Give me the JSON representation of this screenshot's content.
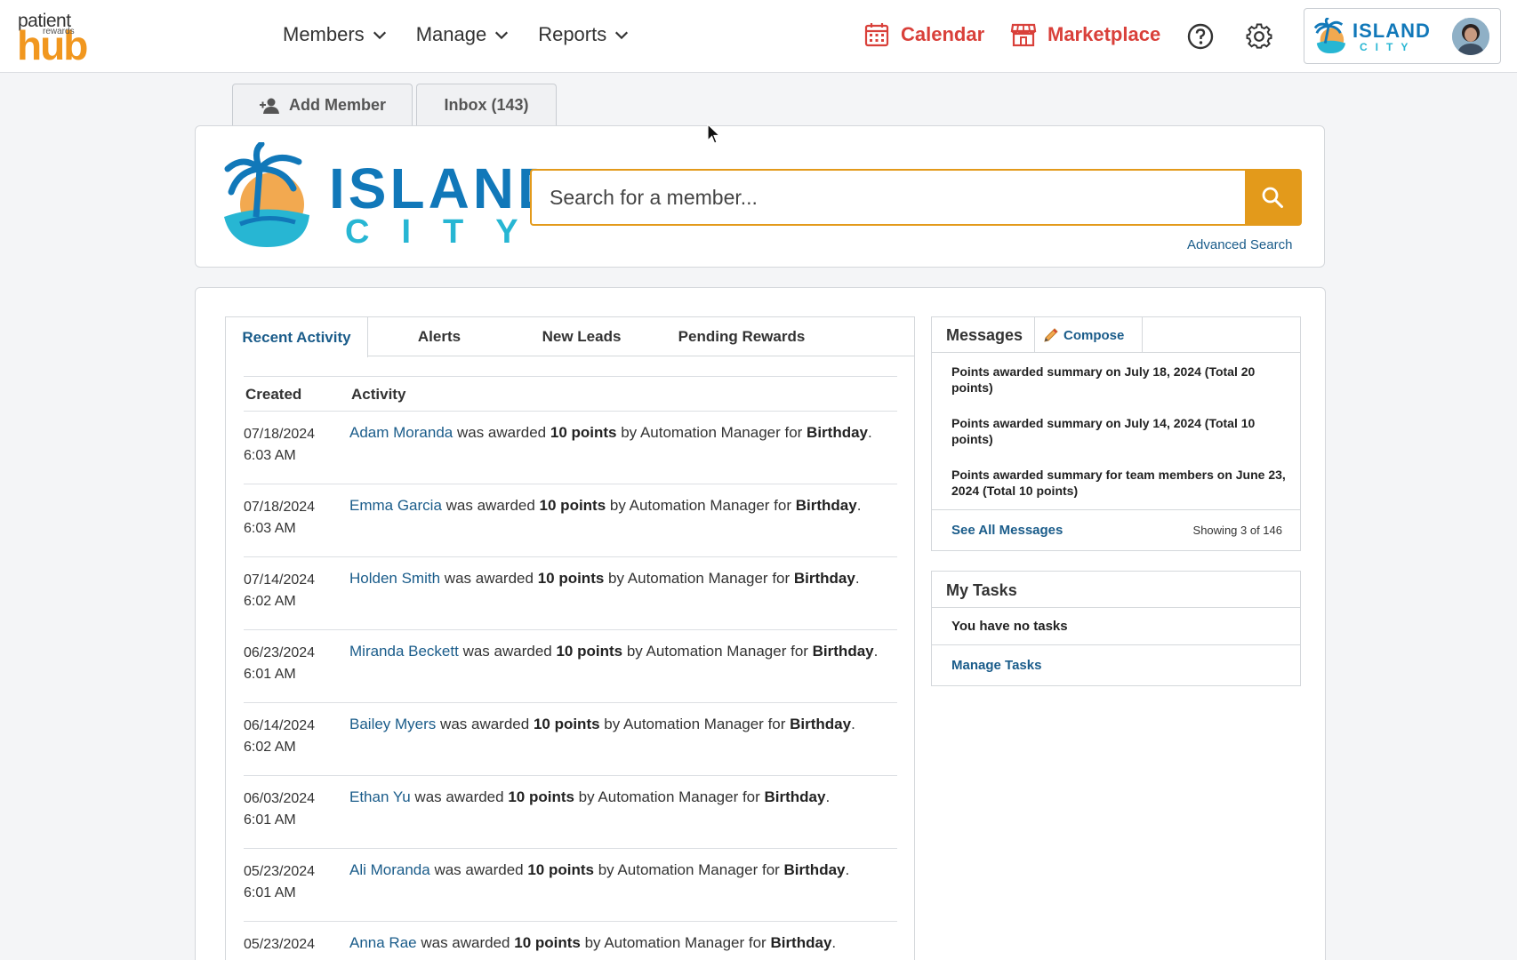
{
  "brand": {
    "line1": "patient",
    "line2": "rewards",
    "line3": "hub"
  },
  "nav": [
    {
      "label": "Members"
    },
    {
      "label": "Manage"
    },
    {
      "label": "Reports"
    }
  ],
  "top_links": {
    "calendar": "Calendar",
    "marketplace": "Marketplace"
  },
  "org": {
    "name_line1": "ISLAND",
    "name_line2": "CITY"
  },
  "action_tabs": {
    "add_member": "Add Member",
    "inbox": "Inbox (143)"
  },
  "search": {
    "placeholder": "Search for a member...",
    "advanced": "Advanced Search"
  },
  "activity": {
    "tabs": [
      "Recent Activity",
      "Alerts",
      "New Leads",
      "Pending Rewards"
    ],
    "columns": {
      "created": "Created",
      "activity": "Activity"
    },
    "rows": [
      {
        "date": "07/18/2024",
        "time": "6:03 AM",
        "member": "Adam Moranda",
        "t1": " was awarded ",
        "points": "10 points",
        "t2": " by Automation Manager for ",
        "reason": "Birthday",
        "end": "."
      },
      {
        "date": "07/18/2024",
        "time": "6:03 AM",
        "member": "Emma Garcia",
        "t1": " was awarded ",
        "points": "10 points",
        "t2": " by Automation Manager for ",
        "reason": "Birthday",
        "end": "."
      },
      {
        "date": "07/14/2024",
        "time": "6:02 AM",
        "member": "Holden Smith",
        "t1": " was awarded ",
        "points": "10 points",
        "t2": " by Automation Manager for ",
        "reason": "Birthday",
        "end": "."
      },
      {
        "date": "06/23/2024",
        "time": "6:01 AM",
        "member": "Miranda Beckett",
        "t1": " was awarded ",
        "points": "10 points",
        "t2": " by Automation Manager for ",
        "reason": "Birthday",
        "end": "."
      },
      {
        "date": "06/14/2024",
        "time": "6:02 AM",
        "member": "Bailey Myers",
        "t1": " was awarded ",
        "points": "10 points",
        "t2": " by Automation Manager for ",
        "reason": "Birthday",
        "end": "."
      },
      {
        "date": "06/03/2024",
        "time": "6:01 AM",
        "member": "Ethan Yu",
        "t1": " was awarded ",
        "points": "10 points",
        "t2": " by Automation Manager for ",
        "reason": "Birthday",
        "end": "."
      },
      {
        "date": "05/23/2024",
        "time": "6:01 AM",
        "member": "Ali Moranda",
        "t1": " was awarded ",
        "points": "10 points",
        "t2": " by Automation Manager for ",
        "reason": "Birthday",
        "end": "."
      },
      {
        "date": "05/23/2024",
        "time": "",
        "member": "Anna Rae",
        "t1": " was awarded ",
        "points": "10 points",
        "t2": " by Automation Manager for ",
        "reason": "Birthday",
        "end": "."
      }
    ]
  },
  "messages": {
    "title": "Messages",
    "compose": "Compose",
    "items": [
      "Points awarded summary on July 18, 2024 (Total 20 points)",
      "Points awarded summary on July 14, 2024 (Total 10 points)",
      "Points awarded summary for team members on June 23, 2024 (Total 10 points)"
    ],
    "see_all": "See All Messages",
    "showing": "Showing 3 of 146"
  },
  "tasks": {
    "title": "My Tasks",
    "empty": "You have no tasks",
    "manage": "Manage Tasks"
  },
  "colors": {
    "accent": "#e39a1b",
    "link": "#1a5c8a",
    "alert_red": "#d9403a",
    "brand_blue": "#1178b9",
    "brand_cyan": "#27b6d3"
  }
}
